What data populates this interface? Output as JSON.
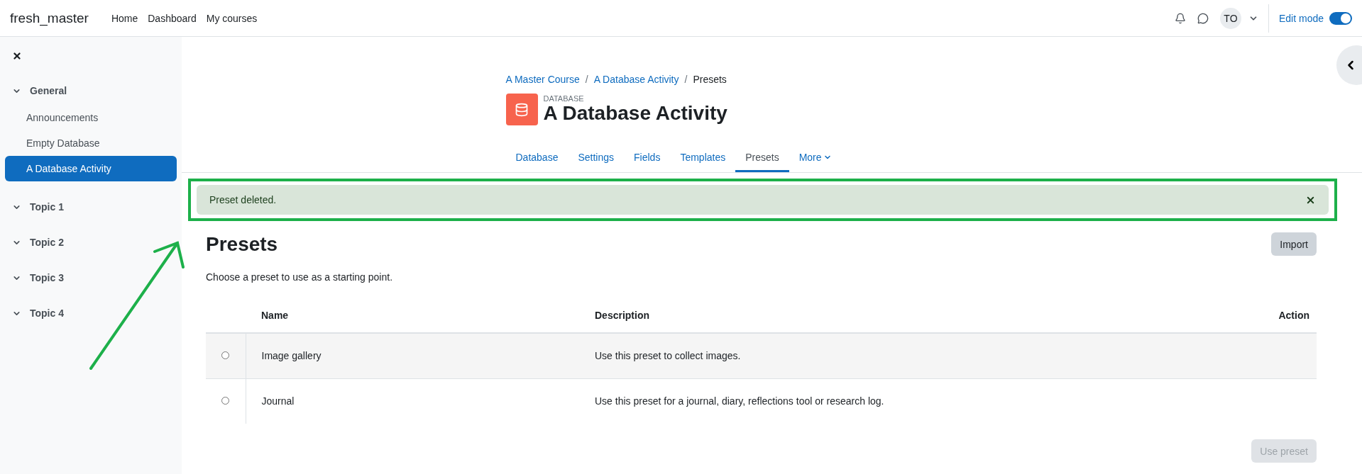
{
  "navbar": {
    "site_name": "fresh_master",
    "links": [
      "Home",
      "Dashboard",
      "My courses"
    ],
    "user_initials": "TO",
    "edit_mode": {
      "label": "Edit mode",
      "on": true
    }
  },
  "sidebar": {
    "sections": [
      {
        "title": "General",
        "expanded": true,
        "children": [
          {
            "label": "Announcements",
            "selected": false
          },
          {
            "label": "Empty Database",
            "selected": false
          },
          {
            "label": "A Database Activity",
            "selected": true
          }
        ]
      },
      {
        "title": "Topic 1",
        "expanded": true
      },
      {
        "title": "Topic 2",
        "expanded": true
      },
      {
        "title": "Topic 3",
        "expanded": true
      },
      {
        "title": "Topic 4",
        "expanded": true
      }
    ]
  },
  "breadcrumb": [
    {
      "label": "A Master Course",
      "link": true
    },
    {
      "label": "A Database Activity",
      "link": true
    },
    {
      "label": "Presets",
      "link": false
    }
  ],
  "breadcrumb_separator": "/",
  "header": {
    "module_type": "DATABASE",
    "title": "A Database Activity"
  },
  "tabs": [
    {
      "label": "Database",
      "selected": false
    },
    {
      "label": "Settings",
      "selected": false
    },
    {
      "label": "Fields",
      "selected": false
    },
    {
      "label": "Templates",
      "selected": false
    },
    {
      "label": "Presets",
      "selected": true
    },
    {
      "label": "More",
      "selected": false,
      "kind": "dropdown"
    }
  ],
  "alert": {
    "message": "Preset deleted."
  },
  "page": {
    "title": "Presets",
    "import_button": "Import",
    "intro": "Choose a preset to use as a starting point."
  },
  "table": {
    "columns": [
      "Name",
      "Description",
      "Action"
    ],
    "rows": [
      {
        "name": "Image gallery",
        "description": "Use this preset to collect images.",
        "selected": false
      },
      {
        "name": "Journal",
        "description": "Use this preset for a journal, diary, reflections tool or research log.",
        "selected": false
      }
    ]
  },
  "use_preset_button": {
    "label": "Use preset",
    "disabled": true
  }
}
